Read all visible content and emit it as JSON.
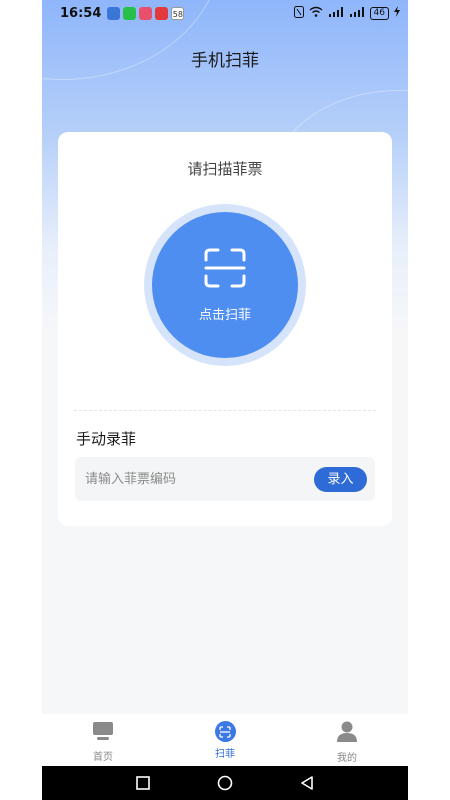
{
  "status": {
    "time": "16:54",
    "notif_badge": "58",
    "signal_1": "4G",
    "signal_2": "4G",
    "battery": "46"
  },
  "header": {
    "title": "手机扫菲"
  },
  "scan_card": {
    "title": "请扫描菲票",
    "button_label": "点击扫菲"
  },
  "manual": {
    "title": "手动录菲",
    "input_placeholder": "请输入菲票编码",
    "input_value": "",
    "submit_label": "录入"
  },
  "tabs": [
    {
      "label": "首页",
      "icon": "monitor-icon",
      "active": false
    },
    {
      "label": "扫菲",
      "icon": "scan-icon",
      "active": true
    },
    {
      "label": "我的",
      "icon": "user-icon",
      "active": false
    }
  ],
  "colors": {
    "accent": "#2f6bd6",
    "scan_button": "#4e8ef0",
    "scan_ring": "#d6e4fb"
  }
}
